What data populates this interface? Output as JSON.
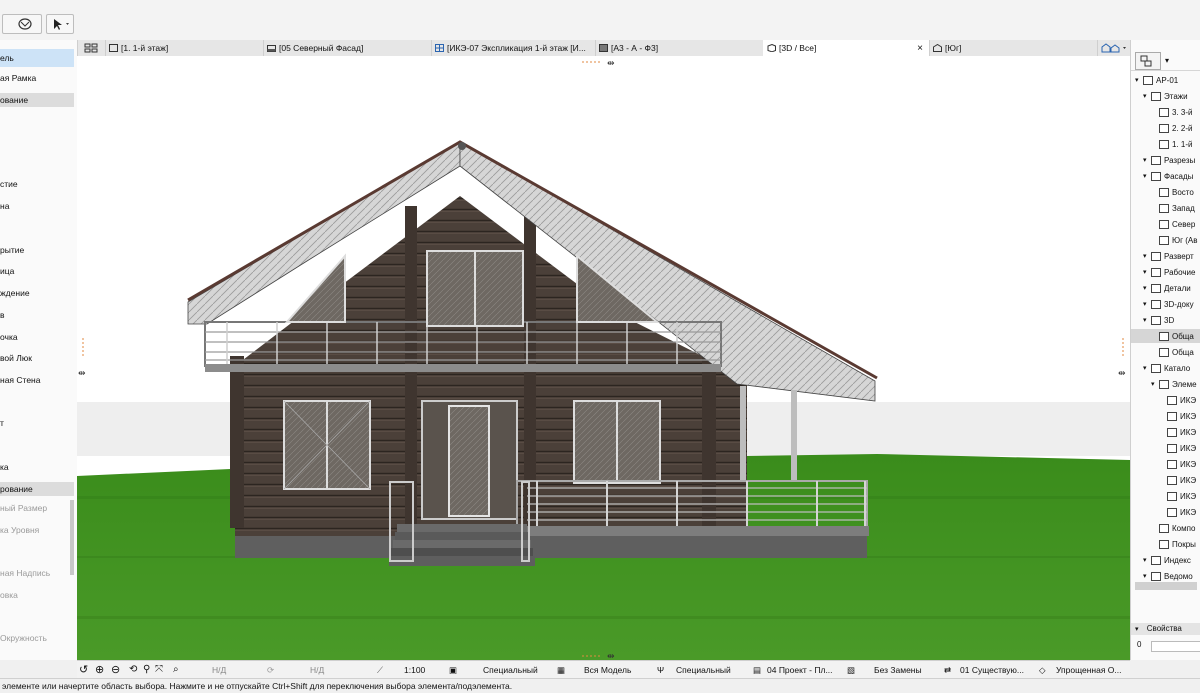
{
  "toolbar": {
    "arrow_icon": "arrow-cursor-icon",
    "orbit_icon": "orbit-icon"
  },
  "tabs": [
    {
      "label": "[1. 1-й этаж]",
      "icon": "floorplan-icon"
    },
    {
      "label": "[05 Северный Фасад]",
      "icon": "elevation-icon"
    },
    {
      "label": "[ИКЭ-07 Экспликация 1-й этаж [И...",
      "icon": "schedule-icon"
    },
    {
      "label": "[А3 - А - Ф3]",
      "icon": "layout-icon"
    },
    {
      "label": "[3D / Все]",
      "icon": "cube-icon",
      "close": "×"
    },
    {
      "label": "[Юг]",
      "icon": "elevation-icon"
    }
  ],
  "left_panel": {
    "items": [
      {
        "label": "ель",
        "style": "sel"
      },
      {
        "label": "ая Рамка",
        "style": "normal"
      },
      {
        "label": "ование",
        "style": "head"
      },
      {
        "label": "стие",
        "style": "normal"
      },
      {
        "label": "на",
        "style": "normal"
      },
      {
        "label": "рытие",
        "style": "normal"
      },
      {
        "label": "ица",
        "style": "normal"
      },
      {
        "label": "ждение",
        "style": "normal"
      },
      {
        "label": "в",
        "style": "normal"
      },
      {
        "label": "очка",
        "style": "normal"
      },
      {
        "label": "вой Люк",
        "style": "normal"
      },
      {
        "label": "ная Стена",
        "style": "normal"
      },
      {
        "label": "т",
        "style": "normal"
      },
      {
        "label": "ка",
        "style": "normal"
      },
      {
        "label": "рование",
        "style": "head"
      },
      {
        "label": "ный Размер",
        "style": "dis"
      },
      {
        "label": "ка Уровня",
        "style": "dis"
      },
      {
        "label": "ная Надпись",
        "style": "dis"
      },
      {
        "label": "овка",
        "style": "dis"
      },
      {
        "label": "Окружность",
        "style": "dis"
      }
    ]
  },
  "navigator": {
    "items": [
      {
        "label": "АР-01",
        "indent": 0,
        "icon": "house-icon"
      },
      {
        "label": "Этажи",
        "indent": 1,
        "icon": "stories-icon"
      },
      {
        "label": "3. 3-й",
        "indent": 2,
        "icon": "story-icon"
      },
      {
        "label": "2. 2-й",
        "indent": 2,
        "icon": "story-icon"
      },
      {
        "label": "1. 1-й",
        "indent": 2,
        "icon": "story-icon"
      },
      {
        "label": "Разрезы",
        "indent": 1,
        "icon": "section-icon"
      },
      {
        "label": "Фасады",
        "indent": 1,
        "icon": "elevation-icon"
      },
      {
        "label": "Восто",
        "indent": 2,
        "icon": "elevation-icon"
      },
      {
        "label": "Запад",
        "indent": 2,
        "icon": "elevation-icon"
      },
      {
        "label": "Север",
        "indent": 2,
        "icon": "elevation-icon"
      },
      {
        "label": "Юг (Ав",
        "indent": 2,
        "icon": "elevation-icon"
      },
      {
        "label": "Разверт",
        "indent": 1,
        "icon": "interior-icon"
      },
      {
        "label": "Рабочие",
        "indent": 1,
        "icon": "worksheet-icon"
      },
      {
        "label": "Детали",
        "indent": 1,
        "icon": "detail-icon"
      },
      {
        "label": "3D-доку",
        "indent": 1,
        "icon": "3d-doc-icon"
      },
      {
        "label": "3D",
        "indent": 1,
        "icon": "cube-icon"
      },
      {
        "label": "Обща",
        "indent": 2,
        "icon": "cube-icon"
      },
      {
        "label": "Обща",
        "indent": 2,
        "icon": "cube-icon"
      },
      {
        "label": "Катало",
        "indent": 1,
        "icon": "catalog-icon"
      },
      {
        "label": "Элеме",
        "indent": 2,
        "icon": "schedule-icon"
      },
      {
        "label": "ИКЭ",
        "indent": 3,
        "icon": "table-icon"
      },
      {
        "label": "ИКЭ",
        "indent": 3,
        "icon": "table-icon"
      },
      {
        "label": "ИКЭ",
        "indent": 3,
        "icon": "table-icon"
      },
      {
        "label": "ИКЭ",
        "indent": 3,
        "icon": "table-icon"
      },
      {
        "label": "ИКЭ",
        "indent": 3,
        "icon": "table-icon"
      },
      {
        "label": "ИКЭ",
        "indent": 3,
        "icon": "table-icon"
      },
      {
        "label": "ИКЭ",
        "indent": 3,
        "icon": "table-icon"
      },
      {
        "label": "ИКЭ",
        "indent": 3,
        "icon": "table-icon"
      },
      {
        "label": "Компо",
        "indent": 2,
        "icon": "component-icon"
      },
      {
        "label": "Покры",
        "indent": 2,
        "icon": "surface-icon"
      },
      {
        "label": "Индекс",
        "indent": 1,
        "icon": "index-icon"
      },
      {
        "label": "Ведомо",
        "indent": 1,
        "icon": "list-icon"
      }
    ],
    "properties_label": "Свойства",
    "properties_value": "0"
  },
  "view_bar": {
    "na1": "Н/Д",
    "na2": "Н/Д",
    "scale": "1:100",
    "layer_combo": "Специальный",
    "model_view": "Вся Модель",
    "pen_set": "Специальный",
    "mvo": "04 Проект - Пл...",
    "override": "Без Замены",
    "renovation": "01 Существую...",
    "structure": "Упрощенная О..."
  },
  "status_text": "элементе или начертите область выбора. Нажмите и не отпускайте Ctrl+Shift для переключения выбора элемента/подэлемента.",
  "colors": {
    "accent": "#cde3f7",
    "log_wall": "#4a3f38",
    "roof": "#d9d9d9",
    "grass": "#3d8a1f",
    "sky": "#ffffff"
  }
}
